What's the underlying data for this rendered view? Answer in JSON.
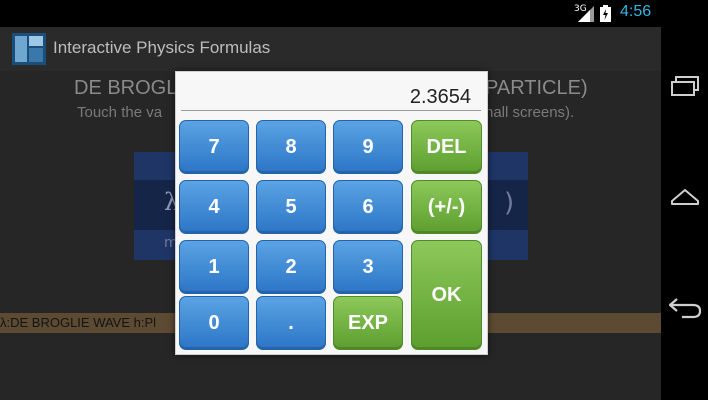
{
  "status_bar": {
    "network": "3G",
    "time": "4:56",
    "clock_color": "#33b5e5"
  },
  "app": {
    "title": "Interactive Physics Formulas"
  },
  "background": {
    "heading_left": "DE BROGLI",
    "heading_right": "PARTICLE)",
    "instruction_left": "Touch the va",
    "instruction_right": "hall screens).",
    "lambda": "λ",
    "paren": ")",
    "panel_sub": "m",
    "legend": "λ:DE BROGLIE WAVE  h:Pl"
  },
  "keypad": {
    "display_value": "2.3654",
    "keys": {
      "k7": "7",
      "k8": "8",
      "k9": "9",
      "del": "DEL",
      "k4": "4",
      "k5": "5",
      "k6": "6",
      "sign": "(+/-)",
      "k1": "1",
      "k2": "2",
      "k3": "3",
      "ok": "OK",
      "k0": "0",
      "dot": ".",
      "exp": "EXP"
    },
    "colors": {
      "digit_key": "#3f8bd6",
      "action_key": "#6cb23f"
    }
  },
  "nav_bar": {
    "icons": [
      "recent-apps-icon",
      "home-icon",
      "back-icon"
    ]
  }
}
